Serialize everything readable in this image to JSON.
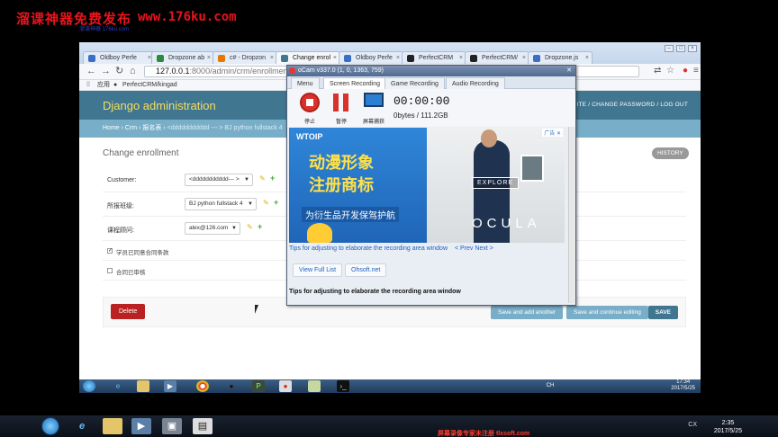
{
  "watermark": {
    "title": "溜课神器免费发布",
    "url": "www.176ku.com",
    "sub": "溜课神器 176ku.com",
    "footer": "屏幕录像专家未注册 tlxsoft.com"
  },
  "browser": {
    "tabs": [
      {
        "label": "Oldboy Perfe",
        "color": "#3a6fc5"
      },
      {
        "label": "Dropzone ab",
        "color": "#2b8a3e"
      },
      {
        "label": "c# - Dropzon",
        "color": "#e67700"
      },
      {
        "label": "Change enrol",
        "color": "#417690"
      },
      {
        "label": "Oldboy Perfe",
        "color": "#3a6fc5"
      },
      {
        "label": "PerfectCRM",
        "color": "#222222"
      },
      {
        "label": "PerfectCRM/",
        "color": "#222222"
      },
      {
        "label": "Dropzone.js",
        "color": "#3a6fc5"
      }
    ],
    "active_tab": 3,
    "address": {
      "host": "127.0.0.1",
      "path": ":8000/admin/crm/enrollment"
    },
    "bookmarks": {
      "apps": "应用",
      "repo": "PerfectCRM/kingad"
    }
  },
  "admin": {
    "brand": "Django administration",
    "user_tools": "VIEW SITE / CHANGE PASSWORD / LOG OUT",
    "breadcrumb": {
      "home": "Home",
      "app": "Crm",
      "model": "报名表",
      "current": "<ddddddddddd --- > BJ python fullstack 4"
    },
    "title": "Change enrollment",
    "history": "HISTORY",
    "fields": [
      {
        "label": "Customer:",
        "value": "<ddddddddddd--- >"
      },
      {
        "label": "所报班级:",
        "value": "BJ python fullstack 4"
      },
      {
        "label": "课程顾问:",
        "value": "alex@126.com"
      }
    ],
    "checkboxes": [
      {
        "label": "学员已同意合同条款",
        "checked": true
      },
      {
        "label": "合同已审核",
        "checked": false
      }
    ],
    "buttons": {
      "delete": "Delete",
      "save_add": "Save and add another",
      "save_continue": "Save and continue editing",
      "save": "SAVE"
    }
  },
  "ocam": {
    "title": "oCam v337.0 (1, 0, 1363, 759)",
    "close": "✕",
    "tabs": [
      "Menu",
      "Screen Recording",
      "Game Recording",
      "Audio Recording"
    ],
    "active_tab": 1,
    "controls": {
      "stop": "停止",
      "pause": "暂停",
      "screen": "屏幕捕获"
    },
    "timer": "00:00:00",
    "size": "0bytes / 111.2GB",
    "ad": {
      "logo": "WTOIP",
      "line1": "动漫形象",
      "line2": "注册商标",
      "line3": "为衍生品开发保驾护航",
      "badge": "广告 ✕",
      "explore": "EXPLORE",
      "brand": "OCULA"
    },
    "tip_link": "Tips for adjusting to elaborate the recording area window",
    "nav": "< Prev Next >",
    "view_full_list": "View Full List",
    "ohsoft": "Ohsoft.net",
    "tip_bold": "Tips for adjusting to elaborate the recording area window"
  },
  "inner_taskbar": {
    "time": "17:34",
    "date": "2017/5/25",
    "lang": "CH"
  },
  "outer_taskbar": {
    "time": "2:35",
    "date": "2017/5/25",
    "lang": "CX"
  }
}
